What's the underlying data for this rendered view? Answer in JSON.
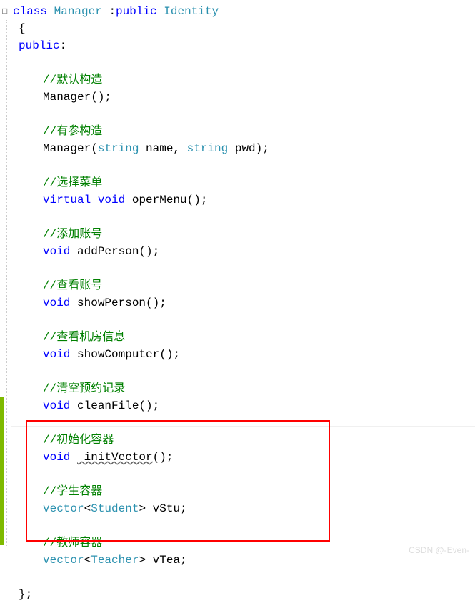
{
  "code": {
    "l1_class": "class",
    "l1_name": "Manager",
    "l1_colon": " :",
    "l1_public": "public",
    "l1_base": " Identity",
    "l2_brace": "{",
    "l3_public": "public",
    "l3_colon": ":",
    "c_default": "//默认构造",
    "m_default": "Manager();",
    "c_param": "//有参构造",
    "m_param_pre": "Manager(",
    "m_param_t1": "string",
    "m_param_n1": " name, ",
    "m_param_t2": "string",
    "m_param_n2": " pwd);",
    "c_menu": "//选择菜单",
    "m_menu_virtual": "virtual",
    "m_menu_void": " void",
    "m_menu_name": " operMenu();",
    "c_add": "//添加账号",
    "m_add_void": "void",
    "m_add_name": " addPerson();",
    "c_show": "//查看账号",
    "m_show_void": "void",
    "m_show_name": " showPerson();",
    "c_comp": "//查看机房信息",
    "m_comp_void": "void",
    "m_comp_name": " showComputer();",
    "c_clean": "//清空预约记录",
    "m_clean_void": "void",
    "m_clean_name": " cleanFile();",
    "c_init": "//初始化容器",
    "m_init_void": "void",
    "m_init_name": " initVector",
    "m_init_paren": "();",
    "c_stu": "//学生容器",
    "m_stu_vec": "vector",
    "m_stu_lt": "<",
    "m_stu_type": "Student",
    "m_stu_gt": "> vStu;",
    "c_tea": "//教师容器",
    "m_tea_vec": "vector",
    "m_tea_lt": "<",
    "m_tea_type": "Teacher",
    "m_tea_gt": "> vTea;",
    "close_brace": "};"
  },
  "watermark": "CSDN @-Even-"
}
